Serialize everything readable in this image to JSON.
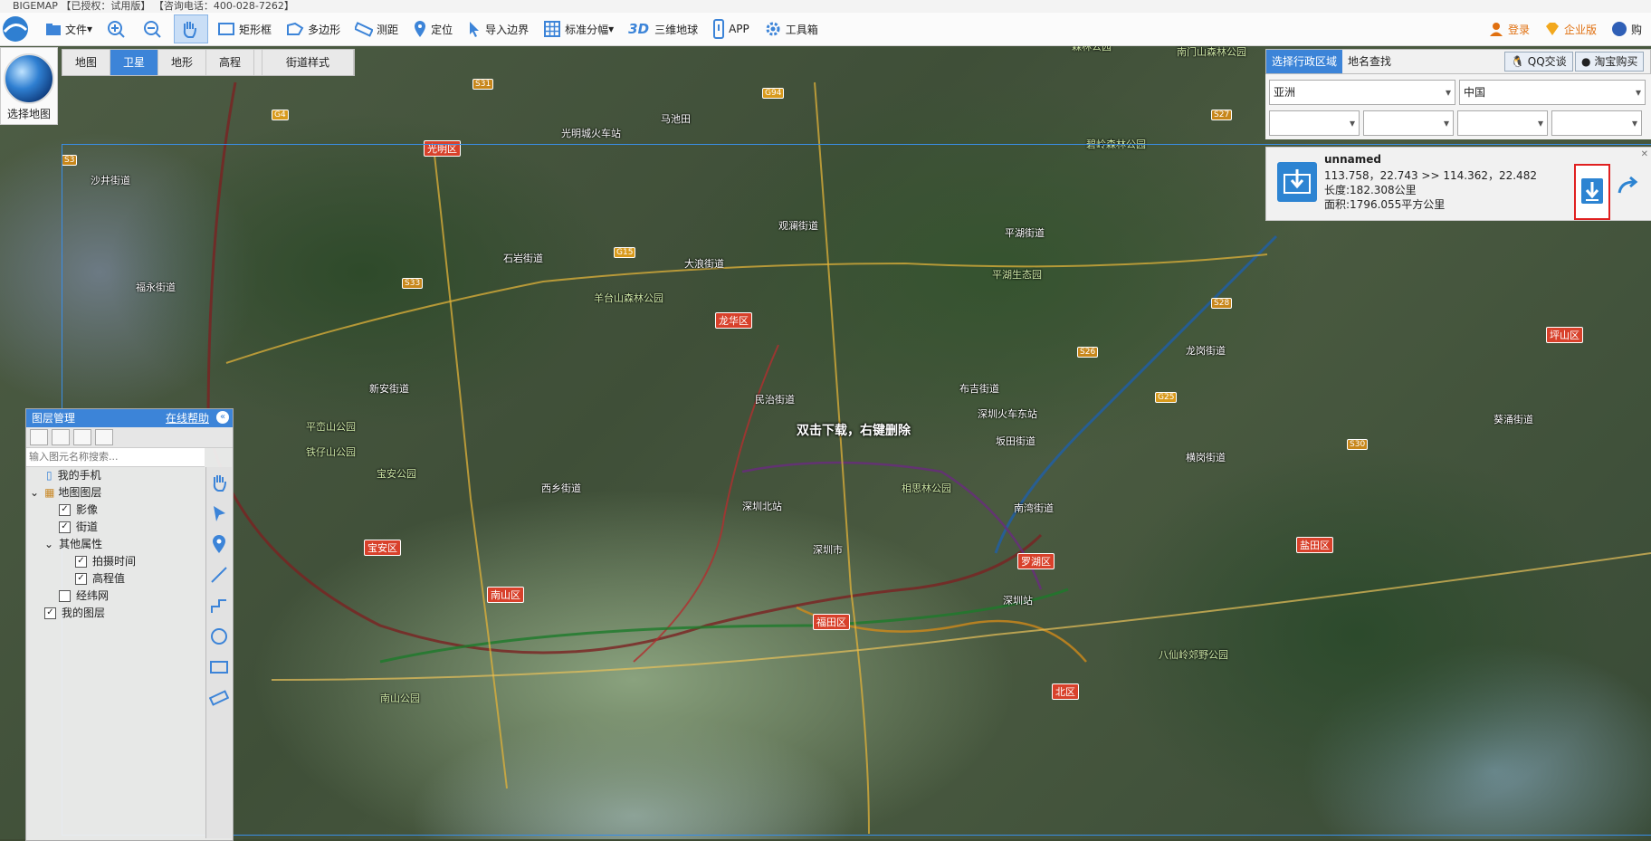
{
  "titlebar": {
    "text": "BIGEMAP 【已授权：试用版】 【咨询电话：400-028-7262】"
  },
  "toolbar": {
    "items": [
      {
        "label": "文件"
      },
      {
        "label": ""
      },
      {
        "label": ""
      },
      {
        "label": ""
      },
      {
        "label": "矩形框"
      },
      {
        "label": "多边形"
      },
      {
        "label": "测距"
      },
      {
        "label": "定位"
      },
      {
        "label": "导入边界"
      },
      {
        "label": "标准分幅"
      },
      {
        "label": "三维地球",
        "prefix": "3D"
      },
      {
        "label": "APP"
      },
      {
        "label": "工具箱"
      }
    ],
    "right": [
      {
        "label": "登录"
      },
      {
        "label": "企业版"
      },
      {
        "label": "购"
      }
    ],
    "accent": "#3c84d8"
  },
  "select_map": {
    "label": "选择地图"
  },
  "map_types": [
    {
      "label": "地图",
      "active": false
    },
    {
      "label": "卫星",
      "active": true
    },
    {
      "label": "地形",
      "active": false
    },
    {
      "label": "高程",
      "active": false
    }
  ],
  "street_style": "街道样式",
  "region_panel": {
    "tabs": [
      "选择行政区域",
      "地名查找"
    ],
    "buttons": [
      "QQ交谈",
      "淘宝购买"
    ],
    "continent": "亚洲",
    "country": "中国",
    "empty_selects": [
      "",
      "",
      "",
      ""
    ]
  },
  "info_card": {
    "name": "unnamed",
    "coords": "113.758，22.743 >> 114.362，22.482",
    "length": "长度:182.308公里",
    "area": "面积:1796.055平方公里"
  },
  "layer_panel": {
    "title": "图层管理",
    "help": "在线帮助",
    "search_placeholder": "输入图元名称搜索...",
    "tree": [
      {
        "label": "我的手机",
        "level": 1,
        "check": null
      },
      {
        "label": "地图图层",
        "level": 0,
        "check": null
      },
      {
        "label": "影像",
        "level": 2,
        "check": true
      },
      {
        "label": "街道",
        "level": 2,
        "check": true
      },
      {
        "label": "其他属性",
        "level": 1,
        "check": null
      },
      {
        "label": "拍摄时间",
        "level": 3,
        "check": true
      },
      {
        "label": "高程值",
        "level": 3,
        "check": true
      },
      {
        "label": "经纬网",
        "level": 2,
        "check": false
      },
      {
        "label": "我的图层",
        "level": 0,
        "check": true
      }
    ]
  },
  "map_labels": {
    "center_hint": "双击下载，右键删除",
    "places": [
      "光明城火车站",
      "深圳北站",
      "深圳火车东站",
      "深圳站",
      "深圳市",
      "马池田",
      "石岩街道",
      "大浪街道",
      "民治街道",
      "平湖街道",
      "龙岗街道",
      "观澜街道",
      "坂田街道",
      "西乡街道",
      "新安街道",
      "布吉街道",
      "福永街道",
      "沙井街道",
      "横岗街道",
      "葵涌街道",
      "南湾街道",
      "福田区",
      "罗湖区",
      "南山区",
      "宝安区",
      "龙华区",
      "光明区",
      "北区",
      "坪山区",
      "盐田区"
    ],
    "districts": [
      "光明区",
      "龙华区",
      "宝安区",
      "南山区",
      "福田区",
      "罗湖区",
      "盐田区",
      "坪山区",
      "北区"
    ],
    "highways": [
      "G4",
      "G15",
      "G94",
      "G25",
      "S3",
      "S31",
      "S33",
      "S26",
      "S27",
      "S28",
      "S30"
    ],
    "parks": [
      "羊台山森林公园",
      "平湖生态园",
      "碧岭森林公园",
      "相思林公园",
      "宝安公园",
      "铁仔山公园",
      "平峦山公园",
      "八仙岭郊野公园",
      "南山公园",
      "森林公园",
      "南门山森林公园"
    ]
  }
}
